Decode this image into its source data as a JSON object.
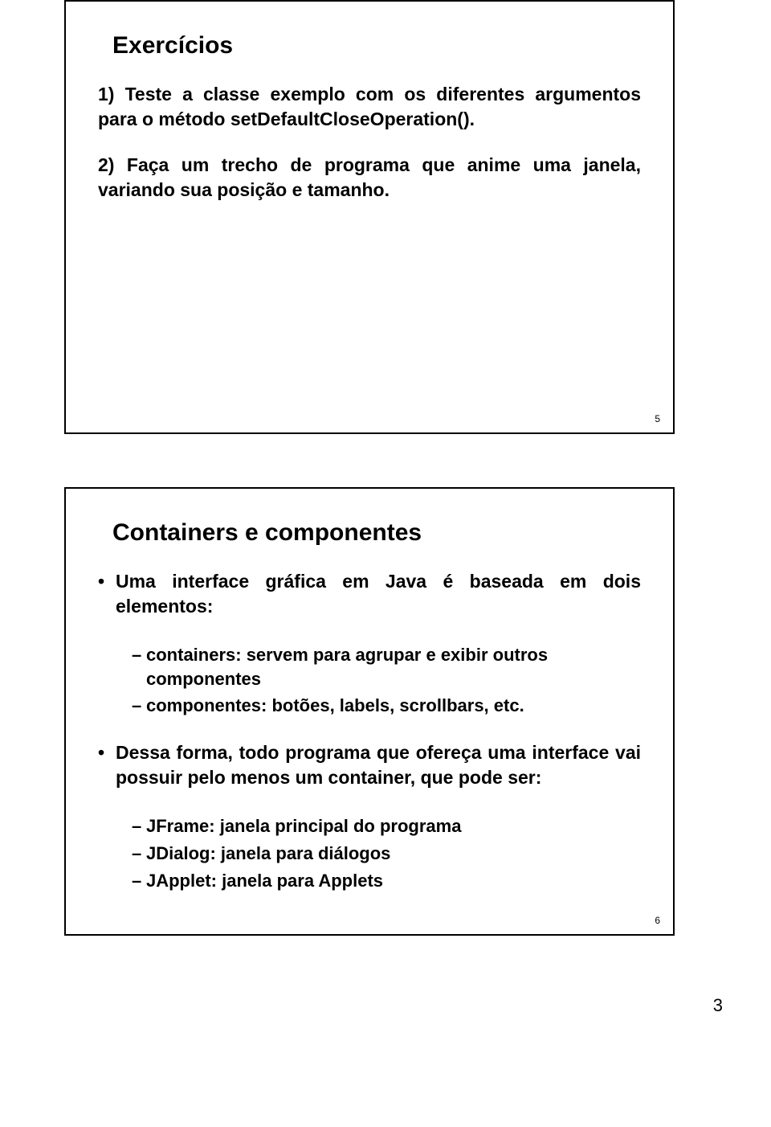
{
  "page_number": "3",
  "slide1": {
    "title": "Exercícios",
    "ex1": "1) Teste a classe exemplo com os diferentes argumentos para o método setDefaultCloseOperation().",
    "ex2": "2) Faça um trecho de programa que anime uma janela, variando sua posição e tamanho.",
    "slide_num": "5"
  },
  "slide2": {
    "title": "Containers e componentes",
    "b1": "Uma interface gráfica em Java é baseada em dois elementos:",
    "b1a": "containers: servem para agrupar e exibir outros componentes",
    "b1b": "componentes: botões, labels, scrollbars, etc.",
    "b2": "Dessa forma, todo programa que ofereça uma interface vai possuir pelo menos um container, que pode ser:",
    "b2a": "JFrame: janela principal do programa",
    "b2b": "JDialog: janela para diálogos",
    "b2c": "JApplet: janela para Applets",
    "slide_num": "6"
  }
}
